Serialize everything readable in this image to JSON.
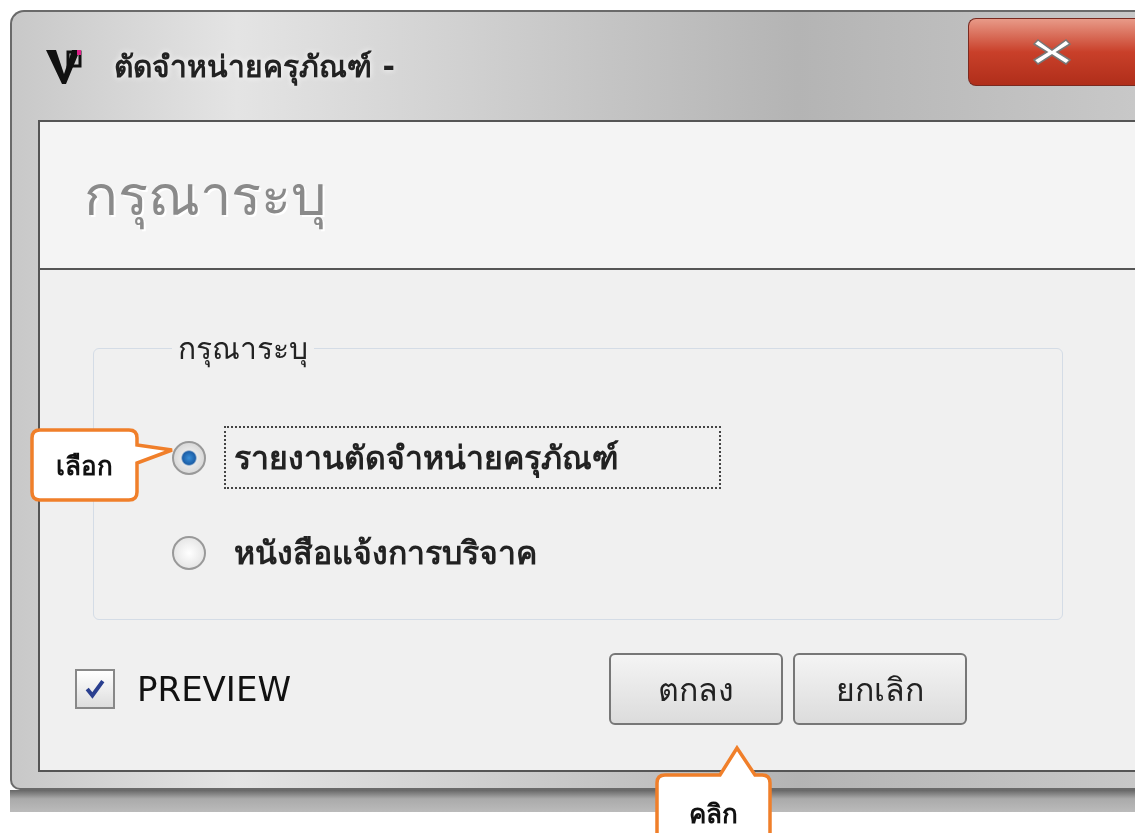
{
  "window": {
    "title": "ตัดจำหน่ายครุภัณฑ์ -"
  },
  "header": {
    "title": "กรุณาระบุ"
  },
  "group": {
    "legend": "กรุณาระบุ",
    "options": [
      {
        "label": "รายงานตัดจำหน่ายครุภัณฑ์",
        "selected": true
      },
      {
        "label": "หนังสือแจ้งการบริจาค",
        "selected": false
      }
    ]
  },
  "preview": {
    "label": "PREVIEW",
    "checked": true
  },
  "buttons": [
    {
      "label": "ตกลง"
    },
    {
      "label": "ยกเลิก"
    }
  ],
  "callouts": [
    {
      "text": "เลือก",
      "kind": "left"
    },
    {
      "text": "คลิก",
      "kind": "below"
    }
  ]
}
